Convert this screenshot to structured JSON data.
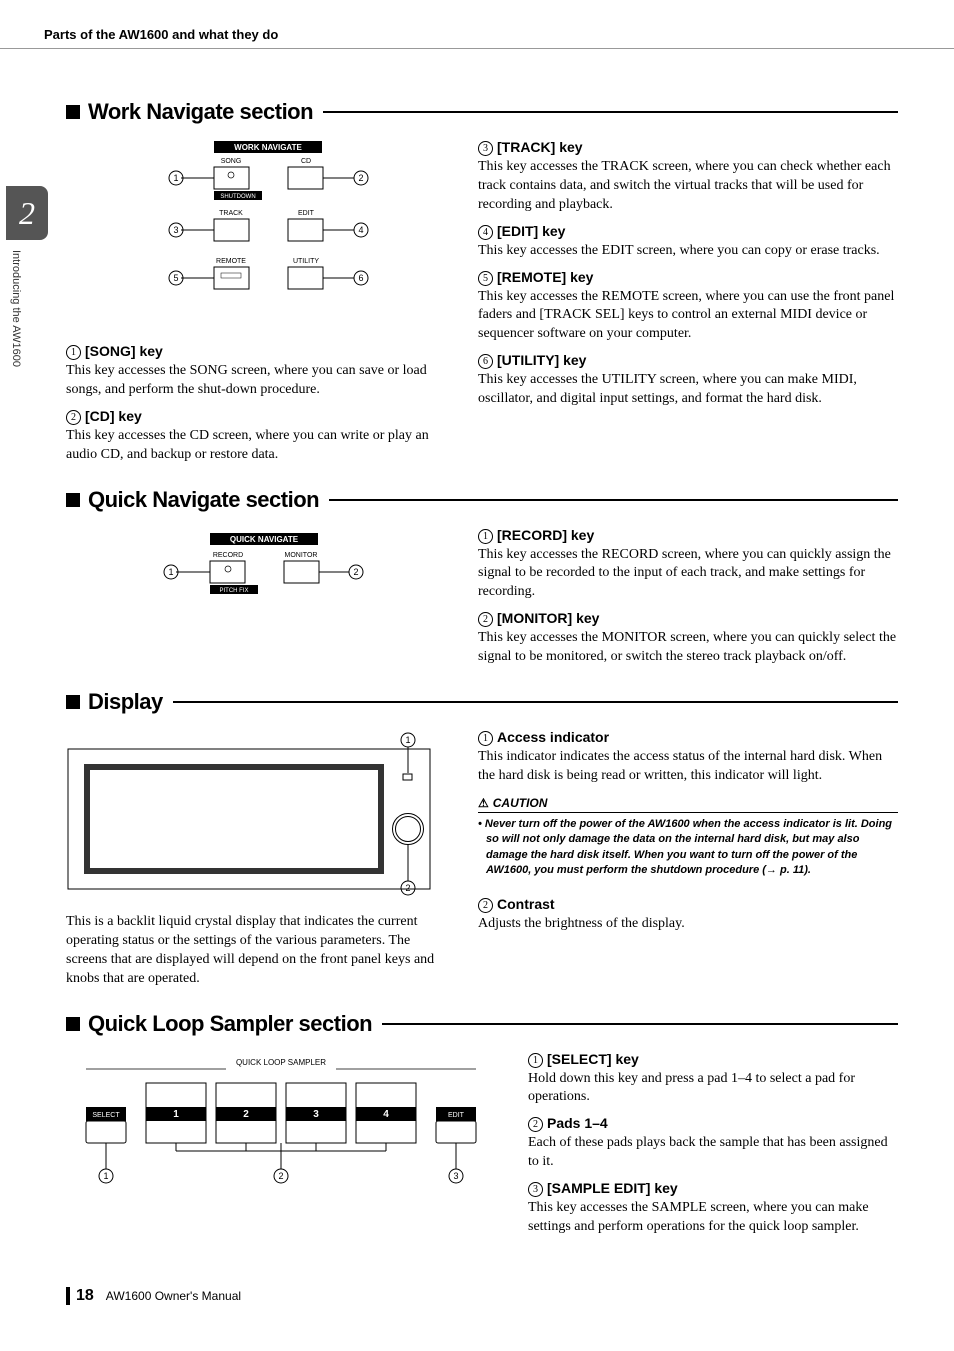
{
  "header": {
    "title": "Parts of the AW1600 and what they do"
  },
  "side": {
    "chapter": "2",
    "label": "Introducing the AW1600"
  },
  "sections": {
    "work_navigate": {
      "title": "Work Navigate section",
      "diagram": {
        "header": "WORK NAVIGATE",
        "labels": [
          "SONG",
          "CD",
          "SHUTDOWN",
          "TRACK",
          "EDIT",
          "REMOTE",
          "UTILITY"
        ]
      },
      "items": [
        {
          "num": "1",
          "label": "[SONG] key",
          "desc": "This key accesses the SONG screen, where you can save or load songs, and perform the shut-down procedure."
        },
        {
          "num": "2",
          "label": "[CD] key",
          "desc": "This key accesses the CD screen, where you can write or play an audio CD, and backup or restore data."
        },
        {
          "num": "3",
          "label": "[TRACK] key",
          "desc": "This key accesses the TRACK screen, where you can check whether each track contains data, and switch the virtual tracks that will be used for recording and playback."
        },
        {
          "num": "4",
          "label": "[EDIT] key",
          "desc": "This key accesses the EDIT screen, where you can copy or erase tracks."
        },
        {
          "num": "5",
          "label": "[REMOTE] key",
          "desc": "This key accesses the REMOTE screen, where you can use the front panel faders and [TRACK SEL] keys to control an external MIDI device or sequencer software on your computer."
        },
        {
          "num": "6",
          "label": "[UTILITY] key",
          "desc": "This key accesses the UTILITY screen, where you can make MIDI, oscillator, and digital input settings, and format the hard disk."
        }
      ]
    },
    "quick_navigate": {
      "title": "Quick Navigate section",
      "diagram": {
        "header": "QUICK NAVIGATE",
        "labels": [
          "RECORD",
          "MONITOR",
          "PITCH FIX"
        ]
      },
      "items": [
        {
          "num": "1",
          "label": "[RECORD] key",
          "desc": "This key accesses the RECORD screen, where you can quickly assign the signal to be recorded to the input of each track, and make settings for recording."
        },
        {
          "num": "2",
          "label": "[MONITOR] key",
          "desc": "This key accesses the MONITOR screen, where you can quickly select the signal to be monitored, or switch the stereo track playback on/off."
        }
      ]
    },
    "display": {
      "title": "Display",
      "left_desc": "This is a backlit liquid crystal display that indicates the current operating status or the settings of the various parameters. The screens that are displayed will depend on the front panel keys and knobs that are operated.",
      "items": [
        {
          "num": "1",
          "label": "Access indicator",
          "desc": "This indicator indicates the access status of the internal hard disk. When the hard disk is being read or written, this indicator will light."
        },
        {
          "num": "2",
          "label": "Contrast",
          "desc": "Adjusts the brightness of the display."
        }
      ],
      "caution": {
        "label": "CAUTION",
        "text": "Never turn off the power of the AW1600 when the access indicator is lit. Doing so will not only damage the data on the internal hard disk, but may also damage the hard disk itself. When you want to turn off the power of the AW1600, you must perform the shutdown procedure (→ p. 11)."
      }
    },
    "quick_loop": {
      "title": "Quick Loop Sampler section",
      "diagram": {
        "header": "QUICK LOOP SAMPLER",
        "select": "SELECT",
        "edit": "EDIT",
        "pads": [
          "1",
          "2",
          "3",
          "4"
        ]
      },
      "items": [
        {
          "num": "1",
          "label": "[SELECT] key",
          "desc": "Hold down this key and press a pad 1–4 to select a pad for operations."
        },
        {
          "num": "2",
          "label": "Pads 1–4",
          "desc": "Each of these pads plays back the sample that has been assigned to it."
        },
        {
          "num": "3",
          "label": "[SAMPLE EDIT] key",
          "desc": "This key accesses the SAMPLE screen, where you can make settings and perform operations for the quick loop sampler."
        }
      ]
    }
  },
  "footer": {
    "page": "18",
    "manual": "AW1600  Owner's Manual"
  }
}
